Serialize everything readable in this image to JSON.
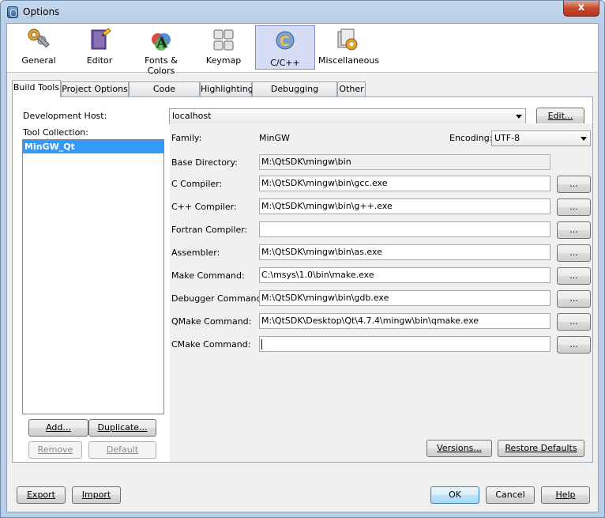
{
  "window": {
    "title": "Options",
    "close_glyph": "x"
  },
  "categories": [
    {
      "label": "General",
      "icon": "wrench-gears-icon"
    },
    {
      "label": "Editor",
      "icon": "editor-book-pencil-icon"
    },
    {
      "label": "Fonts & Colors",
      "icon": "fonts-colors-icon"
    },
    {
      "label": "Keymap",
      "icon": "keyboard-keys-icon"
    },
    {
      "label": "C/C++",
      "icon": "cpp-icon",
      "active": true
    },
    {
      "label": "Miscellaneous",
      "icon": "misc-gear-icon"
    }
  ],
  "tabs": [
    "Build Tools",
    "Project Options",
    "Code Assistance",
    "Highlighting",
    "Debugging Options",
    "Other"
  ],
  "build_tools": {
    "dev_host_label": "Development Host:",
    "dev_host_value": "localhost",
    "edit_label": "Edit...",
    "tool_collection_label": "Tool Collection:",
    "tool_collections": [
      "MinGW_Qt"
    ],
    "add_label": "Add...",
    "duplicate_label": "Duplicate...",
    "remove_label": "Remove",
    "default_label": "Default",
    "family_label": "Family:",
    "family_value": "MinGW",
    "encoding_label": "Encoding:",
    "encoding_value": "UTF-8",
    "base_dir_label": "Base Directory:",
    "base_dir_value": "M:\\QtSDK\\mingw\\bin",
    "browse_label": "...",
    "tools": [
      {
        "label": "C Compiler:",
        "value": "M:\\QtSDK\\mingw\\bin\\gcc.exe"
      },
      {
        "label": "C++ Compiler:",
        "value": "M:\\QtSDK\\mingw\\bin\\g++.exe"
      },
      {
        "label": "Fortran Compiler:",
        "value": ""
      },
      {
        "label": "Assembler:",
        "value": "M:\\QtSDK\\mingw\\bin\\as.exe"
      },
      {
        "label": "Make Command:",
        "value": "C:\\msys\\1.0\\bin\\make.exe"
      },
      {
        "label": "Debugger Command:",
        "value": "M:\\QtSDK\\mingw\\bin\\gdb.exe"
      },
      {
        "label": "QMake Command:",
        "value": "M:\\QtSDK\\Desktop\\Qt\\4.7.4\\mingw\\bin\\qmake.exe"
      },
      {
        "label": "CMake Command:",
        "value": ""
      }
    ],
    "versions_label": "Versions...",
    "restore_defaults_label": "Restore Defaults"
  },
  "footer": {
    "export_label": "Export",
    "import_label": "Import",
    "ok_label": "OK",
    "cancel_label": "Cancel",
    "help_label": "Help"
  }
}
